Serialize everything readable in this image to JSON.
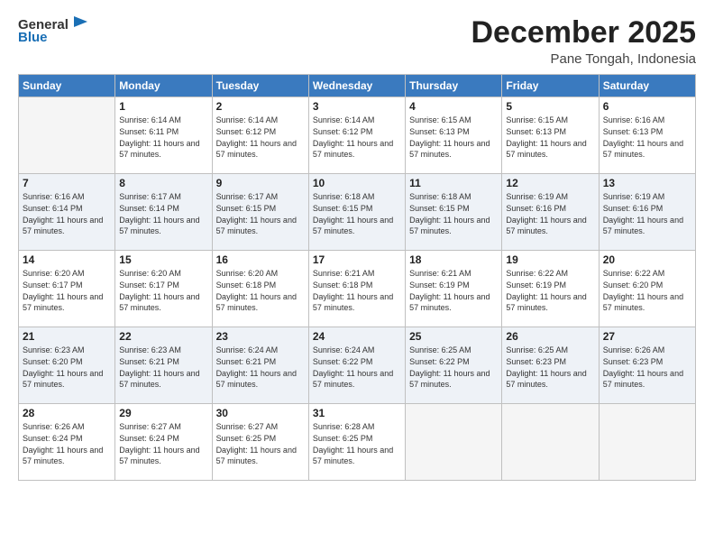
{
  "app": {
    "logo_line1": "General",
    "logo_line2": "Blue",
    "logo_color": "#1a6fb5"
  },
  "header": {
    "month": "December 2025",
    "location": "Pane Tongah, Indonesia"
  },
  "weekdays": [
    "Sunday",
    "Monday",
    "Tuesday",
    "Wednesday",
    "Thursday",
    "Friday",
    "Saturday"
  ],
  "rows": [
    [
      {
        "day": "",
        "empty": true
      },
      {
        "day": "1",
        "sunrise": "Sunrise: 6:14 AM",
        "sunset": "Sunset: 6:11 PM",
        "daylight": "Daylight: 11 hours and 57 minutes."
      },
      {
        "day": "2",
        "sunrise": "Sunrise: 6:14 AM",
        "sunset": "Sunset: 6:12 PM",
        "daylight": "Daylight: 11 hours and 57 minutes."
      },
      {
        "day": "3",
        "sunrise": "Sunrise: 6:14 AM",
        "sunset": "Sunset: 6:12 PM",
        "daylight": "Daylight: 11 hours and 57 minutes."
      },
      {
        "day": "4",
        "sunrise": "Sunrise: 6:15 AM",
        "sunset": "Sunset: 6:13 PM",
        "daylight": "Daylight: 11 hours and 57 minutes."
      },
      {
        "day": "5",
        "sunrise": "Sunrise: 6:15 AM",
        "sunset": "Sunset: 6:13 PM",
        "daylight": "Daylight: 11 hours and 57 minutes."
      },
      {
        "day": "6",
        "sunrise": "Sunrise: 6:16 AM",
        "sunset": "Sunset: 6:13 PM",
        "daylight": "Daylight: 11 hours and 57 minutes."
      }
    ],
    [
      {
        "day": "7",
        "sunrise": "Sunrise: 6:16 AM",
        "sunset": "Sunset: 6:14 PM",
        "daylight": "Daylight: 11 hours and 57 minutes."
      },
      {
        "day": "8",
        "sunrise": "Sunrise: 6:17 AM",
        "sunset": "Sunset: 6:14 PM",
        "daylight": "Daylight: 11 hours and 57 minutes."
      },
      {
        "day": "9",
        "sunrise": "Sunrise: 6:17 AM",
        "sunset": "Sunset: 6:15 PM",
        "daylight": "Daylight: 11 hours and 57 minutes."
      },
      {
        "day": "10",
        "sunrise": "Sunrise: 6:18 AM",
        "sunset": "Sunset: 6:15 PM",
        "daylight": "Daylight: 11 hours and 57 minutes."
      },
      {
        "day": "11",
        "sunrise": "Sunrise: 6:18 AM",
        "sunset": "Sunset: 6:15 PM",
        "daylight": "Daylight: 11 hours and 57 minutes."
      },
      {
        "day": "12",
        "sunrise": "Sunrise: 6:19 AM",
        "sunset": "Sunset: 6:16 PM",
        "daylight": "Daylight: 11 hours and 57 minutes."
      },
      {
        "day": "13",
        "sunrise": "Sunrise: 6:19 AM",
        "sunset": "Sunset: 6:16 PM",
        "daylight": "Daylight: 11 hours and 57 minutes."
      }
    ],
    [
      {
        "day": "14",
        "sunrise": "Sunrise: 6:20 AM",
        "sunset": "Sunset: 6:17 PM",
        "daylight": "Daylight: 11 hours and 57 minutes."
      },
      {
        "day": "15",
        "sunrise": "Sunrise: 6:20 AM",
        "sunset": "Sunset: 6:17 PM",
        "daylight": "Daylight: 11 hours and 57 minutes."
      },
      {
        "day": "16",
        "sunrise": "Sunrise: 6:20 AM",
        "sunset": "Sunset: 6:18 PM",
        "daylight": "Daylight: 11 hours and 57 minutes."
      },
      {
        "day": "17",
        "sunrise": "Sunrise: 6:21 AM",
        "sunset": "Sunset: 6:18 PM",
        "daylight": "Daylight: 11 hours and 57 minutes."
      },
      {
        "day": "18",
        "sunrise": "Sunrise: 6:21 AM",
        "sunset": "Sunset: 6:19 PM",
        "daylight": "Daylight: 11 hours and 57 minutes."
      },
      {
        "day": "19",
        "sunrise": "Sunrise: 6:22 AM",
        "sunset": "Sunset: 6:19 PM",
        "daylight": "Daylight: 11 hours and 57 minutes."
      },
      {
        "day": "20",
        "sunrise": "Sunrise: 6:22 AM",
        "sunset": "Sunset: 6:20 PM",
        "daylight": "Daylight: 11 hours and 57 minutes."
      }
    ],
    [
      {
        "day": "21",
        "sunrise": "Sunrise: 6:23 AM",
        "sunset": "Sunset: 6:20 PM",
        "daylight": "Daylight: 11 hours and 57 minutes."
      },
      {
        "day": "22",
        "sunrise": "Sunrise: 6:23 AM",
        "sunset": "Sunset: 6:21 PM",
        "daylight": "Daylight: 11 hours and 57 minutes."
      },
      {
        "day": "23",
        "sunrise": "Sunrise: 6:24 AM",
        "sunset": "Sunset: 6:21 PM",
        "daylight": "Daylight: 11 hours and 57 minutes."
      },
      {
        "day": "24",
        "sunrise": "Sunrise: 6:24 AM",
        "sunset": "Sunset: 6:22 PM",
        "daylight": "Daylight: 11 hours and 57 minutes."
      },
      {
        "day": "25",
        "sunrise": "Sunrise: 6:25 AM",
        "sunset": "Sunset: 6:22 PM",
        "daylight": "Daylight: 11 hours and 57 minutes."
      },
      {
        "day": "26",
        "sunrise": "Sunrise: 6:25 AM",
        "sunset": "Sunset: 6:23 PM",
        "daylight": "Daylight: 11 hours and 57 minutes."
      },
      {
        "day": "27",
        "sunrise": "Sunrise: 6:26 AM",
        "sunset": "Sunset: 6:23 PM",
        "daylight": "Daylight: 11 hours and 57 minutes."
      }
    ],
    [
      {
        "day": "28",
        "sunrise": "Sunrise: 6:26 AM",
        "sunset": "Sunset: 6:24 PM",
        "daylight": "Daylight: 11 hours and 57 minutes."
      },
      {
        "day": "29",
        "sunrise": "Sunrise: 6:27 AM",
        "sunset": "Sunset: 6:24 PM",
        "daylight": "Daylight: 11 hours and 57 minutes."
      },
      {
        "day": "30",
        "sunrise": "Sunrise: 6:27 AM",
        "sunset": "Sunset: 6:25 PM",
        "daylight": "Daylight: 11 hours and 57 minutes."
      },
      {
        "day": "31",
        "sunrise": "Sunrise: 6:28 AM",
        "sunset": "Sunset: 6:25 PM",
        "daylight": "Daylight: 11 hours and 57 minutes."
      },
      {
        "day": "",
        "empty": true
      },
      {
        "day": "",
        "empty": true
      },
      {
        "day": "",
        "empty": true
      }
    ]
  ]
}
